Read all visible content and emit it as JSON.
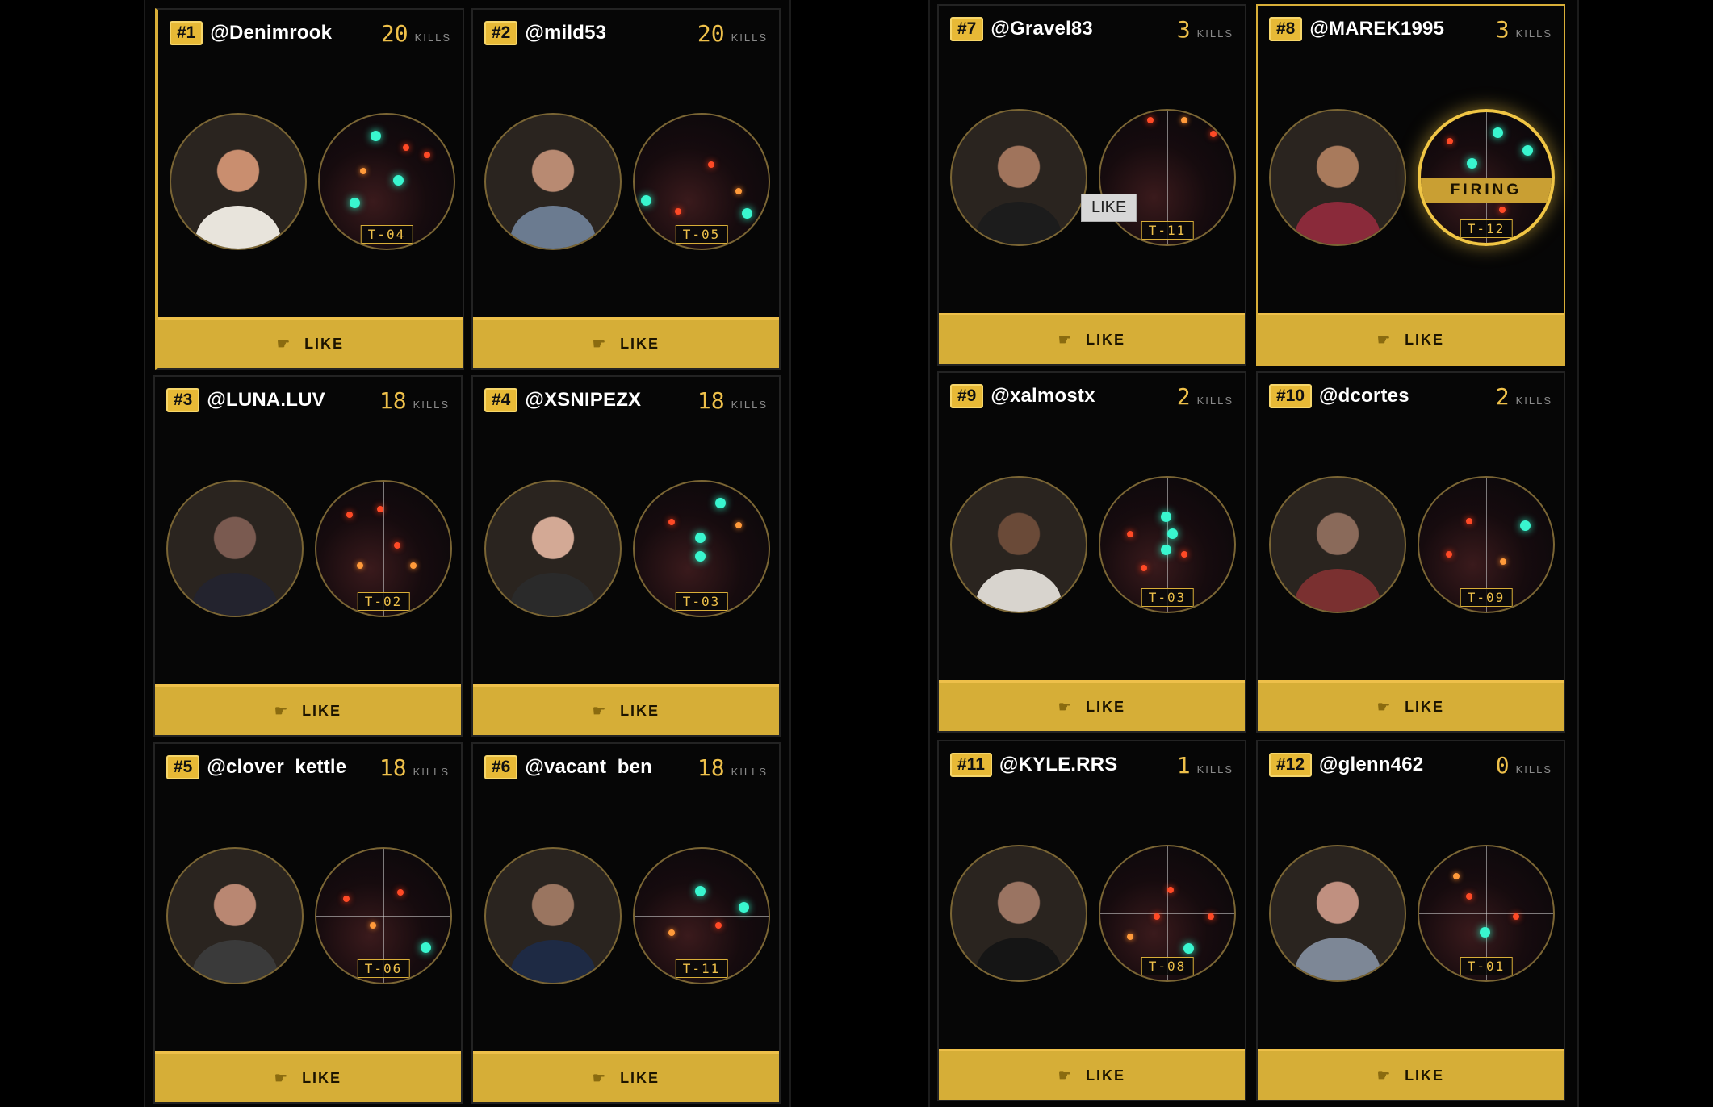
{
  "like_label": "LIKE",
  "kills_label": "KILLS",
  "firing_label": "FIRING",
  "tooltip_label": "LIKE",
  "players": [
    {
      "rank": "#1",
      "handle": "@Denimrook",
      "kills": "20",
      "target": "T-04"
    },
    {
      "rank": "#2",
      "handle": "@mild53",
      "kills": "20",
      "target": "T-05"
    },
    {
      "rank": "#3",
      "handle": "@LUNA.LUV",
      "kills": "18",
      "target": "T-02"
    },
    {
      "rank": "#4",
      "handle": "@XSNIPEZX",
      "kills": "18",
      "target": "T-03"
    },
    {
      "rank": "#5",
      "handle": "@clover_kettle",
      "kills": "18",
      "target": "T-06"
    },
    {
      "rank": "#6",
      "handle": "@vacant_ben",
      "kills": "18",
      "target": "T-11"
    },
    {
      "rank": "#7",
      "handle": "@Gravel83",
      "kills": "3",
      "target": "T-11"
    },
    {
      "rank": "#8",
      "handle": "@MAREK1995",
      "kills": "3",
      "target": "T-12"
    },
    {
      "rank": "#9",
      "handle": "@xalmostx",
      "kills": "2",
      "target": "T-03"
    },
    {
      "rank": "#10",
      "handle": "@dcortes",
      "kills": "2",
      "target": "T-09"
    },
    {
      "rank": "#11",
      "handle": "@KYLE.RRS",
      "kills": "1",
      "target": "T-08"
    },
    {
      "rank": "#12",
      "handle": "@glenn462",
      "kills": "0",
      "target": "T-01"
    }
  ],
  "colors": {
    "accent": "#d8ae38",
    "background": "#000000",
    "scope_dot": "#39f6cf"
  },
  "icons": {
    "like": "thumbs-up-icon"
  }
}
